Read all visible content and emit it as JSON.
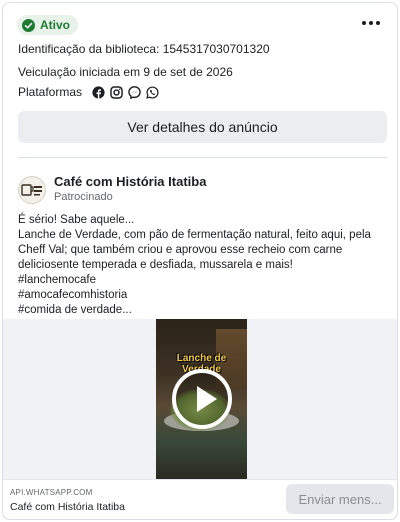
{
  "status": {
    "label": "Ativo",
    "color": "#1f7a33"
  },
  "library_id": "Identificação da biblioteca: 1545317030701320",
  "run_started": "Veiculação iniciada em 9 de set de 2026",
  "platforms": {
    "label": "Plataformas",
    "icons": [
      "facebook-icon",
      "instagram-icon",
      "messenger-icon",
      "whatsapp-icon"
    ]
  },
  "details_button": "Ver detalhes do anúncio",
  "ad": {
    "page_name": "Café com História Itatiba",
    "sponsored": "Patrocinado",
    "text_lines": [
      "É sério! Sabe aquele...",
      "Lanche de Verdade, com pão de fermentação natural, feito aqui, pela Cheff Val; que também criou e aprovou esse recheio com carne deliciosente temperada e desfiada, mussarela e mais!",
      "#lanchemocafe",
      "#amocafecomhistoria",
      "#comida de verdade..."
    ],
    "video_overlay_text": "Lanche de Verdade"
  },
  "footer": {
    "domain": "API.WHATSAPP.COM",
    "title": "Café com História Itatiba",
    "cta": "Enviar mens..."
  }
}
